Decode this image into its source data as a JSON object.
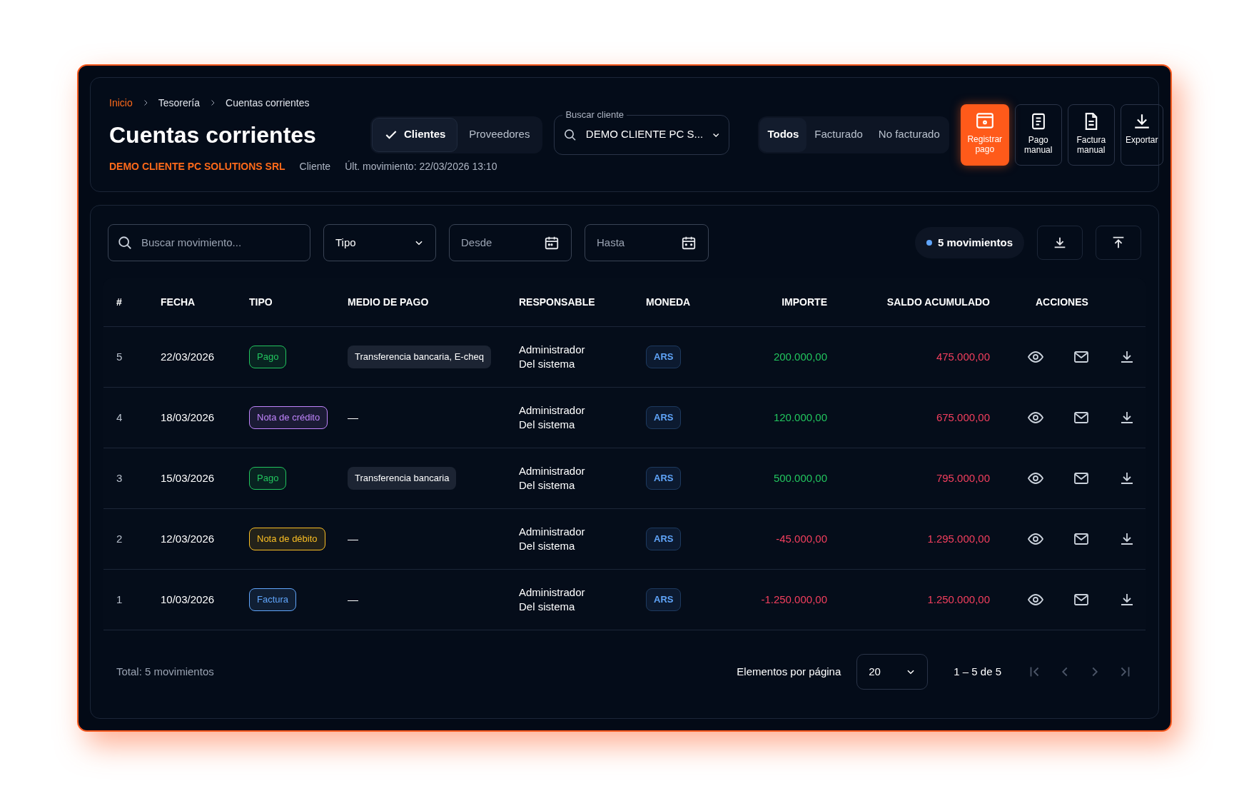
{
  "breadcrumb": [
    "Inicio",
    "Tesorería",
    "Cuentas corrientes"
  ],
  "title": "Cuentas corrientes",
  "subtitle": {
    "client": "DEMO CLIENTE PC SOLUTIONS SRL",
    "role": "Cliente",
    "last_movement": "Últ. movimiento: 22/03/2026 13:10"
  },
  "party_tabs": [
    {
      "label": "Clientes",
      "selected": true
    },
    {
      "label": "Proveedores",
      "selected": false
    }
  ],
  "client_search": {
    "label": "Buscar cliente",
    "value": "DEMO CLIENTE PC S..."
  },
  "billing_tabs": [
    {
      "label": "Todos",
      "selected": true
    },
    {
      "label": "Facturado",
      "selected": false
    },
    {
      "label": "No facturado",
      "selected": false
    }
  ],
  "actions": [
    {
      "kind": "register",
      "label": "Registrar pago",
      "primary": true
    },
    {
      "kind": "manual_payment",
      "label": "Pago manual",
      "primary": false
    },
    {
      "kind": "manual_invoice",
      "label": "Factura manual",
      "primary": false
    },
    {
      "kind": "export",
      "label": "Exportar",
      "primary": false
    }
  ],
  "filters": {
    "search_placeholder": "Buscar movimiento...",
    "type": "Tipo",
    "from_placeholder": "Desde",
    "to_placeholder": "Hasta",
    "count": "5 movimientos"
  },
  "table": {
    "columns": [
      "#",
      "FECHA",
      "TIPO",
      "MEDIO DE PAGO",
      "RESPONSABLE",
      "MONEDA",
      "IMPORTE",
      "SALDO ACUMULADO",
      "ACCIONES"
    ],
    "rows": [
      {
        "n": "5",
        "fecha": "22/03/2026",
        "tipo": {
          "label": "Pago",
          "color": "#22c55e"
        },
        "medio": "Transferencia bancaria, E-cheq",
        "responsable": [
          "Administrador",
          "Del sistema"
        ],
        "moneda": "ARS",
        "importe": {
          "value": "200.000,00",
          "color": "#22c55e"
        },
        "saldo": "475.000,00"
      },
      {
        "n": "4",
        "fecha": "18/03/2026",
        "tipo": {
          "label": "Nota de crédito",
          "color": "#c084fc"
        },
        "medio": "—",
        "responsable": [
          "Administrador",
          "Del sistema"
        ],
        "moneda": "ARS",
        "importe": {
          "value": "120.000,00",
          "color": "#22c55e"
        },
        "saldo": "675.000,00"
      },
      {
        "n": "3",
        "fecha": "15/03/2026",
        "tipo": {
          "label": "Pago",
          "color": "#22c55e"
        },
        "medio": "Transferencia bancaria",
        "responsable": [
          "Administrador",
          "Del sistema"
        ],
        "moneda": "ARS",
        "importe": {
          "value": "500.000,00",
          "color": "#22c55e"
        },
        "saldo": "795.000,00"
      },
      {
        "n": "2",
        "fecha": "12/03/2026",
        "tipo": {
          "label": "Nota de débito",
          "color": "#fbbf24"
        },
        "medio": "—",
        "responsable": [
          "Administrador",
          "Del sistema"
        ],
        "moneda": "ARS",
        "importe": {
          "value": "-45.000,00",
          "color": "#f43f5e"
        },
        "saldo": "1.295.000,00"
      },
      {
        "n": "1",
        "fecha": "10/03/2026",
        "tipo": {
          "label": "Factura",
          "color": "#60a5fa"
        },
        "medio": "—",
        "responsable": [
          "Administrador",
          "Del sistema"
        ],
        "moneda": "ARS",
        "importe": {
          "value": "-1.250.000,00",
          "color": "#f43f5e"
        },
        "saldo": "1.250.000,00"
      }
    ]
  },
  "footer": {
    "total": "Total: 5 movimientos",
    "per_page_label": "Elementos por página",
    "per_page": "20",
    "range": "1 – 5 de 5",
    "nav_disabled": true
  }
}
